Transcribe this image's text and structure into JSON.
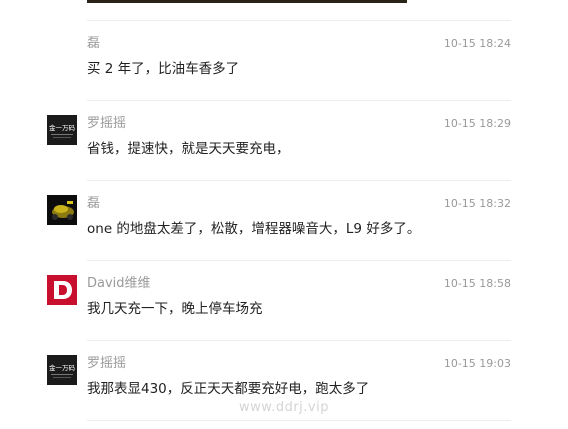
{
  "comments": [
    {
      "author": "磊",
      "time": "10-15 18:24",
      "content": "买 2 年了，比油车香多了",
      "avatar_icon": "none"
    },
    {
      "author": "罗摇摇",
      "time": "10-15 18:29",
      "content": "省钱，提速快，就是天天要充电，",
      "avatar_icon": "text-logo-avatar",
      "avatar_text": "金一万码"
    },
    {
      "author": "磊",
      "time": "10-15 18:32",
      "content": "one 的地盘太差了，松散，增程器噪音大，L9 好多了。",
      "avatar_icon": "car-photo-avatar"
    },
    {
      "author": "David维维",
      "time": "10-15 18:58",
      "content": "我几天充一下，晚上停车场充",
      "avatar_icon": "letter-d-avatar",
      "avatar_color": "#c8102e"
    },
    {
      "author": "罗摇摇",
      "time": "10-15 19:03",
      "content": "我那表显430，反正天天都要充好电，跑太多了",
      "avatar_icon": "text-logo-avatar",
      "avatar_text": "金一万码"
    }
  ],
  "watermark": "www.ddrj.vip"
}
